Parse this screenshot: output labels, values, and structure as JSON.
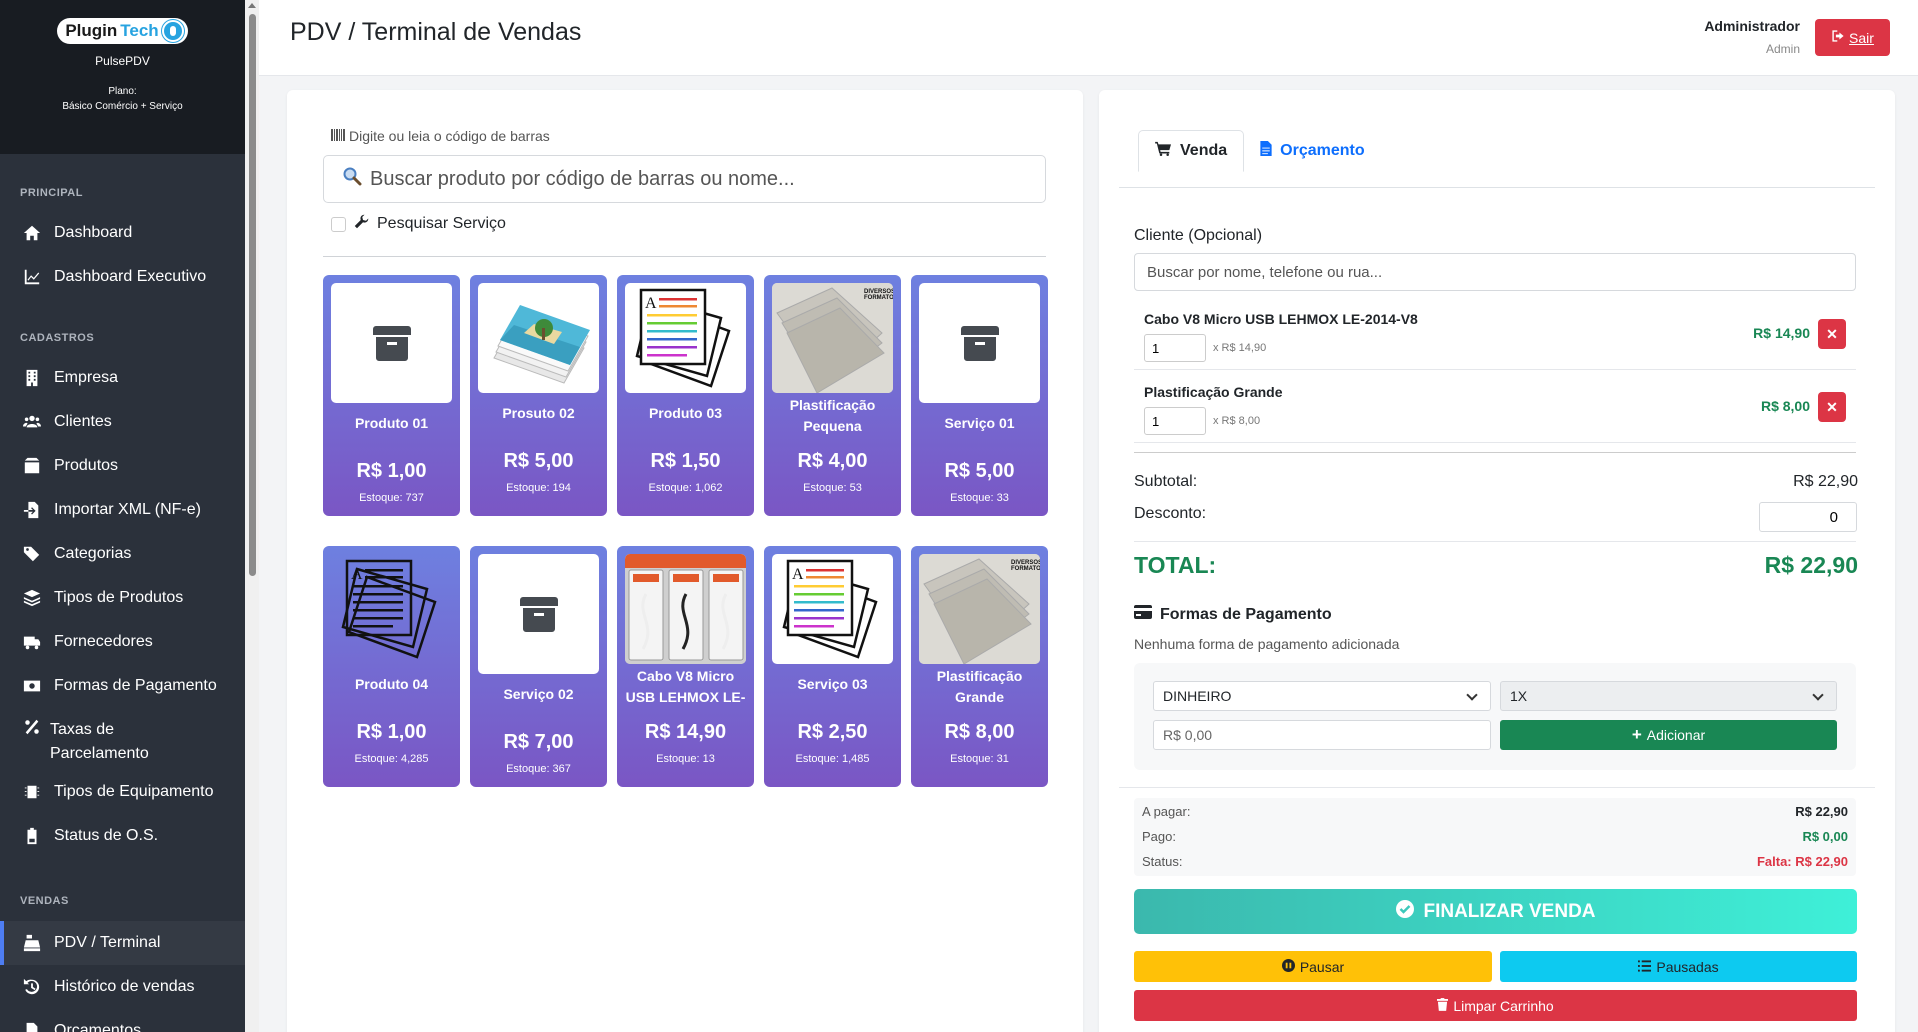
{
  "brand": {
    "logo_text_1": "Plugin",
    "logo_text_2": "Tech",
    "app_name": "PulsePDV",
    "plan_label": "Plano:",
    "plan_name": "Básico Comércio + Serviço"
  },
  "sidebar": {
    "sections": [
      {
        "title": "PRINCIPAL",
        "items": [
          {
            "label": "Dashboard",
            "icon": "home-icon"
          },
          {
            "label": "Dashboard Executivo",
            "icon": "chart-line-icon"
          }
        ]
      },
      {
        "title": "CADASTROS",
        "items": [
          {
            "label": "Empresa",
            "icon": "building-icon"
          },
          {
            "label": "Clientes",
            "icon": "users-icon"
          },
          {
            "label": "Produtos",
            "icon": "box-icon"
          },
          {
            "label": "Importar XML (NF-e)",
            "icon": "file-import-icon"
          },
          {
            "label": "Categorias",
            "icon": "tags-icon"
          },
          {
            "label": "Tipos de Produtos",
            "icon": "layers-icon"
          },
          {
            "label": "Fornecedores",
            "icon": "truck-icon"
          },
          {
            "label": "Formas de Pagamento",
            "icon": "money-bill-icon"
          },
          {
            "label": "Taxas de Parcelamento",
            "icon": "percent-icon"
          },
          {
            "label": "Tipos de Equipamento",
            "icon": "microchip-icon"
          },
          {
            "label": "Status de O.S.",
            "icon": "battery-icon"
          }
        ]
      },
      {
        "title": "VENDAS",
        "items": [
          {
            "label": "PDV / Terminal",
            "icon": "cash-register-icon"
          },
          {
            "label": "Histórico de vendas",
            "icon": "history-icon"
          },
          {
            "label": "Orçamentos",
            "icon": "file-icon"
          }
        ]
      }
    ]
  },
  "header": {
    "title": "PDV / Terminal de Vendas",
    "user_name": "Administrador",
    "user_role": "Admin",
    "logout_label": "Sair"
  },
  "search": {
    "barcode_label": "Digite ou leia o código de barras",
    "placeholder": "Buscar produto por código de barras ou nome...",
    "service_label": "Pesquisar Serviço"
  },
  "products": [
    {
      "name": "Produto 01",
      "price": "R$ 1,00",
      "stock": "Estoque: 737",
      "image": "box-placeholder"
    },
    {
      "name": "Prosuto 02",
      "price": "R$ 5,00",
      "stock": "Estoque: 194",
      "image": "photo-prints"
    },
    {
      "name": "Produto 03",
      "price": "R$ 1,50",
      "stock": "Estoque: 1,062",
      "image": "colored-document"
    },
    {
      "name": "Plastificação Pequena",
      "price": "R$ 4,00",
      "stock": "Estoque: 53",
      "image": "laminating-sheets"
    },
    {
      "name": "Serviço 01",
      "price": "R$ 5,00",
      "stock": "Estoque: 33",
      "image": "box-placeholder"
    },
    {
      "name": "Produto 04",
      "price": "R$ 1,00",
      "stock": "Estoque: 4,285",
      "image": "document"
    },
    {
      "name": "Serviço 02",
      "price": "R$ 7,00",
      "stock": "Estoque: 367",
      "image": "box-placeholder"
    },
    {
      "name": "Cabo V8 Micro USB LEHMOX LE-",
      "price": "R$ 14,90",
      "stock": "Estoque: 13",
      "image": "usb-cables"
    },
    {
      "name": "Serviço 03",
      "price": "R$ 2,50",
      "stock": "Estoque: 1,485",
      "image": "colored-document"
    },
    {
      "name": "Plastificação Grande",
      "price": "R$ 8,00",
      "stock": "Estoque: 31",
      "image": "laminating-sheets"
    }
  ],
  "sale": {
    "tabs": [
      {
        "label": "Venda",
        "icon": "cart-icon"
      },
      {
        "label": "Orçamento",
        "icon": "file-text-icon"
      }
    ],
    "client_label": "Cliente (Opcional)",
    "client_placeholder": "Buscar por nome, telefone ou rua...",
    "cart": [
      {
        "name": "Cabo V8 Micro USB LEHMOX LE-2014-V8",
        "qty": "1",
        "unit": "x R$ 14,90",
        "total": "R$ 14,90"
      },
      {
        "name": "Plastificação Grande",
        "qty": "1",
        "unit": "x R$ 8,00",
        "total": "R$ 8,00"
      }
    ],
    "subtotal_label": "Subtotal:",
    "subtotal": "R$ 22,90",
    "discount_label": "Desconto:",
    "discount": "0",
    "total_label": "TOTAL:",
    "total": "R$ 22,90",
    "payment_title": "Formas de Pagamento",
    "payment_none": "Nenhuma forma de pagamento adicionada",
    "payment_method": "DINHEIRO",
    "installments": "1X",
    "amount_placeholder": "R$ 0,00",
    "add_label": "Adicionar",
    "to_pay_label": "A pagar:",
    "to_pay": "R$ 22,90",
    "paid_label": "Pago:",
    "paid": "R$ 0,00",
    "status_label": "Status:",
    "status": "Falta: R$ 22,90",
    "finish_label": "FINALIZAR VENDA",
    "pause_label": "Pausar",
    "paused_label": "Pausadas",
    "clear_label": "Limpar Carrinho"
  },
  "colors": {
    "accent": "#4e7df2",
    "success": "#198754",
    "danger": "#dc3545",
    "warning": "#ffc107",
    "info": "#0dcaf0",
    "card_top": "#6e80e0",
    "card_bottom": "#7a56c4"
  }
}
